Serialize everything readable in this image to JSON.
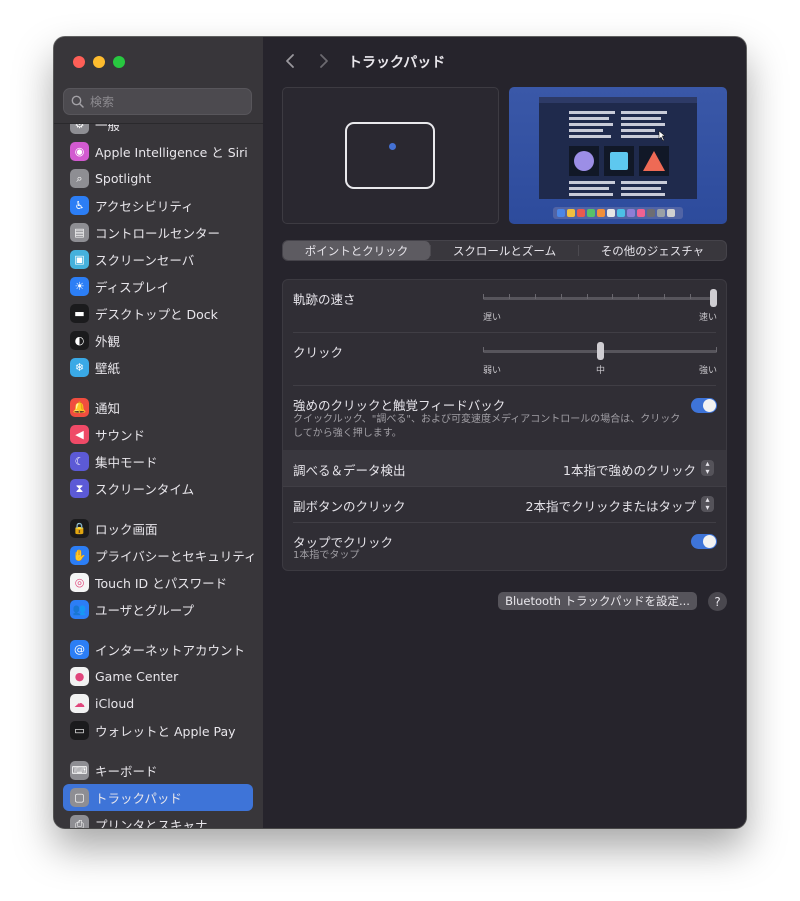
{
  "window": {
    "title": "トラックパッド",
    "search_placeholder": "検索"
  },
  "sidebar": {
    "items": [
      {
        "label": "一般",
        "icon": "gear-icon",
        "color": "#8e8e93"
      },
      {
        "label": "Apple Intelligence と Siri",
        "icon": "siri-icon",
        "color": "#d25ad0"
      },
      {
        "label": "Spotlight",
        "icon": "magnifier-icon",
        "color": "#8e8e93"
      },
      {
        "label": "アクセシビリティ",
        "icon": "accessibility-icon",
        "color": "#2c7ef5"
      },
      {
        "label": "コントロールセンター",
        "icon": "switches-icon",
        "color": "#8e8e93"
      },
      {
        "label": "スクリーンセーバ",
        "icon": "screensaver-icon",
        "color": "#45b1dc"
      },
      {
        "label": "ディスプレイ",
        "icon": "sun-icon",
        "color": "#2c7ef5"
      },
      {
        "label": "デスクトップと Dock",
        "icon": "dock-icon",
        "color": "#1b1b1d"
      },
      {
        "label": "外観",
        "icon": "appearance-icon",
        "color": "#1b1b1d"
      },
      {
        "label": "壁紙",
        "icon": "snowflake-icon",
        "color": "#3aa9e6"
      },
      {
        "label": "通知",
        "icon": "bell-icon",
        "color": "#f04d3f"
      },
      {
        "label": "サウンド",
        "icon": "speaker-icon",
        "color": "#ef4a67"
      },
      {
        "label": "集中モード",
        "icon": "moon-icon",
        "color": "#5c5ad6"
      },
      {
        "label": "スクリーンタイム",
        "icon": "hourglass-icon",
        "color": "#5c5ad6"
      },
      {
        "label": "ロック画面",
        "icon": "lock-icon",
        "color": "#1b1b1d"
      },
      {
        "label": "プライバシーとセキュリティ",
        "icon": "hand-icon",
        "color": "#2c7ef5"
      },
      {
        "label": "Touch ID とパスワード",
        "icon": "fingerprint-icon",
        "color": "#f5f5f5"
      },
      {
        "label": "ユーザとグループ",
        "icon": "users-icon",
        "color": "#2c7ef5"
      },
      {
        "label": "インターネットアカウント",
        "icon": "at-icon",
        "color": "#2c7ef5"
      },
      {
        "label": "Game Center",
        "icon": "gamecenter-icon",
        "color": "#f2f2f2"
      },
      {
        "label": "iCloud",
        "icon": "cloud-icon",
        "color": "#f2f2f2"
      },
      {
        "label": "ウォレットと Apple Pay",
        "icon": "wallet-icon",
        "color": "#1b1b1d"
      },
      {
        "label": "キーボード",
        "icon": "keyboard-icon",
        "color": "#8e8e93"
      },
      {
        "label": "トラックパッド",
        "icon": "trackpad-icon",
        "color": "#8e8e93"
      },
      {
        "label": "プリンタとスキャナ",
        "icon": "printer-icon",
        "color": "#8e8e93"
      }
    ],
    "selected_index": 23
  },
  "tabs": [
    "ポイントとクリック",
    "スクロールとズーム",
    "その他のジェスチャ"
  ],
  "settings": {
    "tracking_speed": {
      "label": "軌跡の速さ",
      "min_label": "遅い",
      "max_label": "速い",
      "value": 1.0
    },
    "click": {
      "label": "クリック",
      "min_label": "弱い",
      "mid_label": "中",
      "max_label": "強い",
      "value": 0.5
    },
    "force_click": {
      "label": "強めのクリックと触覚フィードバック",
      "description_line1": "クイックルック、\"調べる\"、および可変速度メディアコントロールの場合は、クリック",
      "description_line2": "してから強く押します。",
      "enabled": true
    },
    "lookup": {
      "label": "調べる＆データ検出",
      "value": "1本指で強めのクリック"
    },
    "secondary_click": {
      "label": "副ボタンのクリック",
      "value": "2本指でクリックまたはタップ"
    },
    "tap_to_click": {
      "label": "タップでクリック",
      "sub": "1本指でタップ",
      "enabled": true
    }
  },
  "bluetooth_button": "Bluetooth トラックパッドを設定...",
  "help_button": "?",
  "colors": {
    "accent": "#3e74d8",
    "sidebar_bg": "#38363a",
    "main_bg": "#26242c"
  }
}
